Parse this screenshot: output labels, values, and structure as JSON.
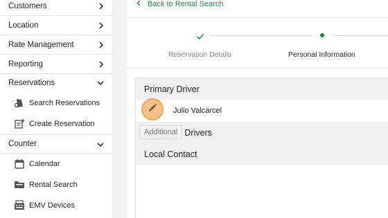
{
  "sidebar": {
    "sections": [
      {
        "label": "Customers",
        "chevron": "chevron-right-icon"
      },
      {
        "label": "Location",
        "chevron": "chevron-right-icon"
      },
      {
        "label": "Rate Management",
        "chevron": "chevron-right-icon"
      },
      {
        "label": "Reporting",
        "chevron": "chevron-right-icon"
      },
      {
        "label": "Reservations",
        "chevron": "chevron-down-icon"
      },
      {
        "label": "Counter",
        "chevron": "chevron-down-icon"
      }
    ],
    "reservation_items": [
      {
        "label": "Search Reservations",
        "icon": "search-reservation-icon"
      },
      {
        "label": "Create Reservation",
        "icon": "create-reservation-icon"
      }
    ],
    "counter_items": [
      {
        "label": "Calendar",
        "icon": "calendar-icon"
      },
      {
        "label": "Rental Search",
        "icon": "folder-icon"
      },
      {
        "label": "EMV Devices",
        "icon": "card-terminal-icon"
      }
    ]
  },
  "main": {
    "back_link": "Back to Rental Search",
    "steps": [
      {
        "label": "Reservation Details",
        "state": "complete"
      },
      {
        "label": "Personal Information",
        "state": "current"
      }
    ],
    "sections": {
      "primary_driver": "Primary Driver",
      "driver_name": "Julio Valcarcel",
      "additional_drivers": "Additional Drivers",
      "local_contact": "Local Contact"
    },
    "tooltip": "Additional"
  },
  "colors": {
    "accent_green": "#1a8a3e",
    "edit_button": "#f6c187"
  }
}
